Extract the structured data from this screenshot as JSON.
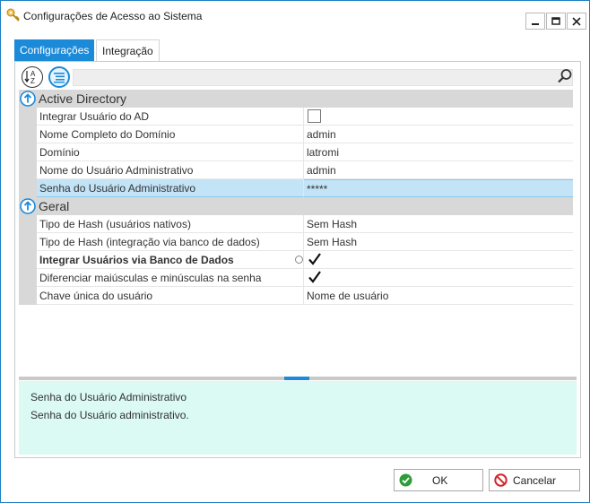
{
  "window": {
    "title": "Configurações de Acesso ao Sistema",
    "icon": "key-icon",
    "controls": [
      "minimize-icon",
      "maximize-icon",
      "close-icon"
    ]
  },
  "tabs": [
    {
      "label": "Configurações",
      "active": true
    },
    {
      "label": "Integração",
      "active": false
    }
  ],
  "toolbar": {
    "sort_icon": "sort-alphabetical-icon",
    "category_icon": "categorized-icon",
    "search_value": "",
    "search_icon": "search-icon"
  },
  "categories": [
    {
      "name": "Active Directory",
      "properties": [
        {
          "name": "Integrar Usuário do AD",
          "value": "",
          "type": "checkbox",
          "checked": false
        },
        {
          "name": "Nome Completo do Domínio",
          "value": "admin",
          "type": "text"
        },
        {
          "name": "Domínio",
          "value": "latromi",
          "type": "text"
        },
        {
          "name": "Nome do Usuário Administrativo",
          "value": "admin",
          "type": "text"
        },
        {
          "name": "Senha do Usuário Administrativo",
          "value": "*****",
          "type": "password",
          "selected": true
        }
      ]
    },
    {
      "name": "Geral",
      "properties": [
        {
          "name": "Tipo de Hash (usuários nativos)",
          "value": "Sem Hash",
          "type": "text"
        },
        {
          "name": "Tipo de Hash (integração via banco de dados)",
          "value": "Sem Hash",
          "type": "text"
        },
        {
          "name": "Integrar Usuários via Banco de Dados",
          "value": "",
          "type": "checkbox",
          "checked": true,
          "bold": true
        },
        {
          "name": "Diferenciar maiúsculas e minúsculas na senha",
          "value": "",
          "type": "checkbox",
          "checked": true
        },
        {
          "name": "Chave única do usuário",
          "value": "Nome de usuário",
          "type": "text"
        }
      ]
    }
  ],
  "description": {
    "title": "Senha do Usuário Administrativo",
    "text": "Senha do Usuário administrativo."
  },
  "buttons": {
    "ok_label": "OK",
    "cancel_label": "Cancelar"
  },
  "colors": {
    "accent": "#1b8ad8",
    "selection": "#c3e4f7",
    "description_bg": "#dafaf3",
    "category_bg": "#d8d8d8"
  }
}
